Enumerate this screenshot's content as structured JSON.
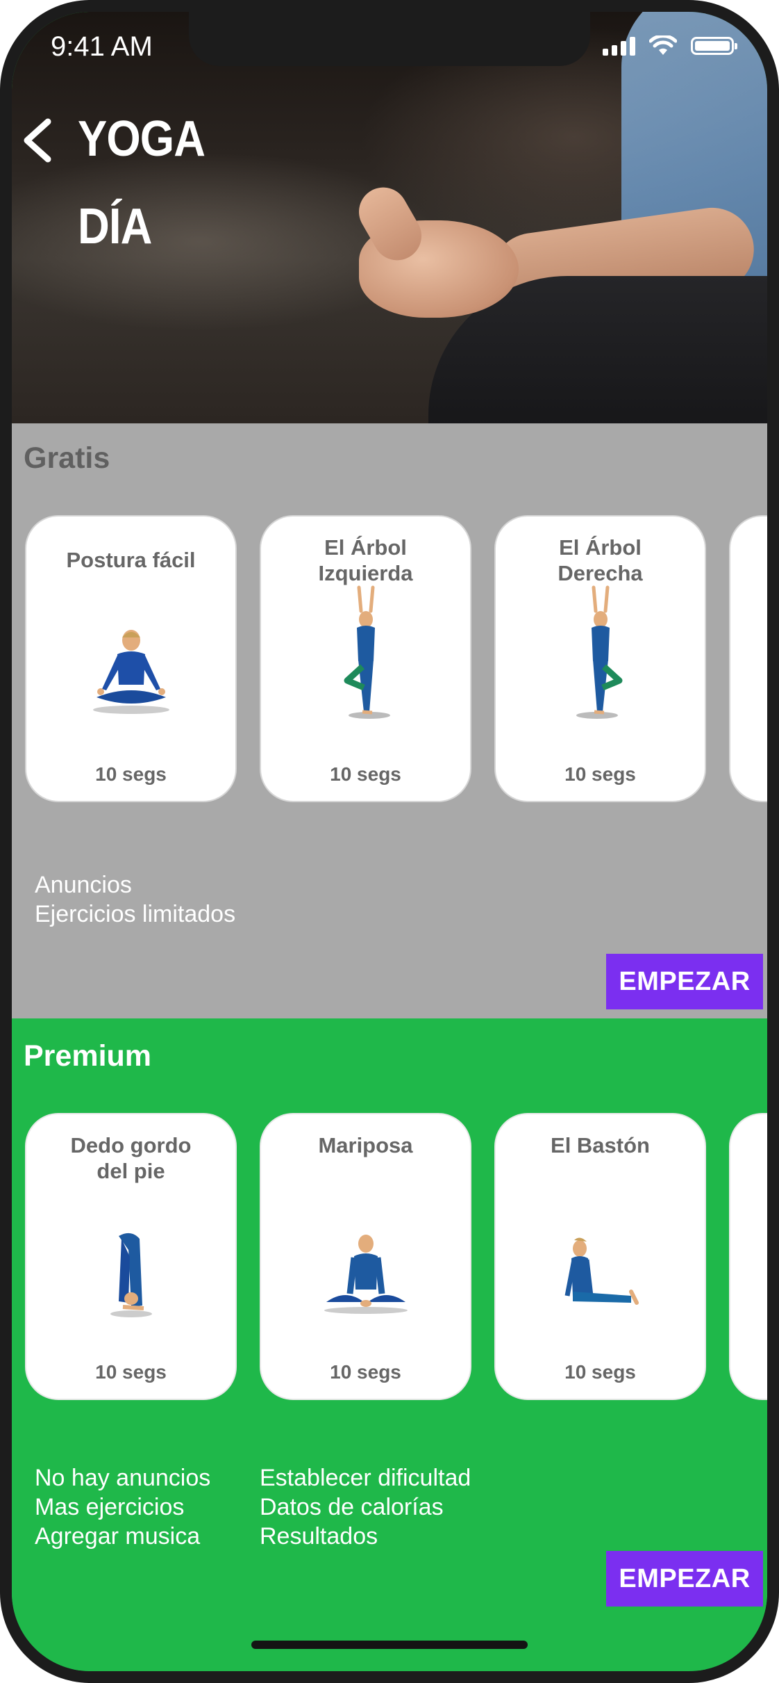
{
  "status_bar": {
    "time": "9:41 AM"
  },
  "header": {
    "title_line1": "YOGA",
    "title_line2": "DÍA"
  },
  "free": {
    "title": "Gratis",
    "cards": [
      {
        "name": "Postura fácil",
        "duration": "10 segs",
        "pose": "lotus"
      },
      {
        "name_line1": "El Árbol",
        "name_line2": "Izquierda",
        "duration": "10 segs",
        "pose": "tree"
      },
      {
        "name_line1": "El Árbol",
        "name_line2": "Derecha",
        "duration": "10 segs",
        "pose": "tree"
      }
    ],
    "features": [
      "Anuncios",
      "Ejercicios limitados"
    ],
    "start_label": "EMPEZAR"
  },
  "premium": {
    "title": "Premium",
    "cards": [
      {
        "name_line1": "Dedo gordo",
        "name_line2": "del pie",
        "duration": "10 segs",
        "pose": "forward-bend"
      },
      {
        "name": "Mariposa",
        "duration": "10 segs",
        "pose": "butterfly"
      },
      {
        "name": "El Bastón",
        "duration": "10 segs",
        "pose": "staff"
      }
    ],
    "features_col1": [
      "No hay anuncios",
      "Mas ejercicios",
      "Agregar musica"
    ],
    "features_col2": [
      "Establecer dificultad",
      "Datos de calorías",
      "Resultados"
    ],
    "start_label": "EMPEZAR"
  },
  "colors": {
    "free_bg": "#a9a9a9",
    "premium_bg": "#1fb84a",
    "button": "#7b2ff0",
    "card_text": "#666666"
  }
}
